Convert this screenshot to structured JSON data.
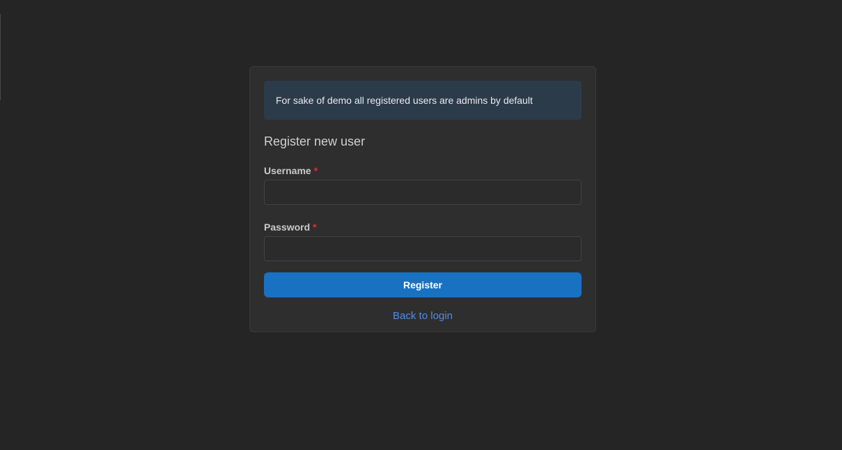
{
  "notice": {
    "text": "For sake of demo all registered users are admins by default"
  },
  "form": {
    "title": "Register new user",
    "username_label": "Username",
    "password_label": "Password",
    "required_marker": "*",
    "username_value": "",
    "password_value": "",
    "submit_label": "Register",
    "back_link": "Back to login"
  },
  "colors": {
    "background": "#252525",
    "card": "#2e2e2e",
    "notice_bg": "#2c3b4a",
    "primary": "#1971c2",
    "link": "#4d8de8",
    "required": "#e03131"
  }
}
